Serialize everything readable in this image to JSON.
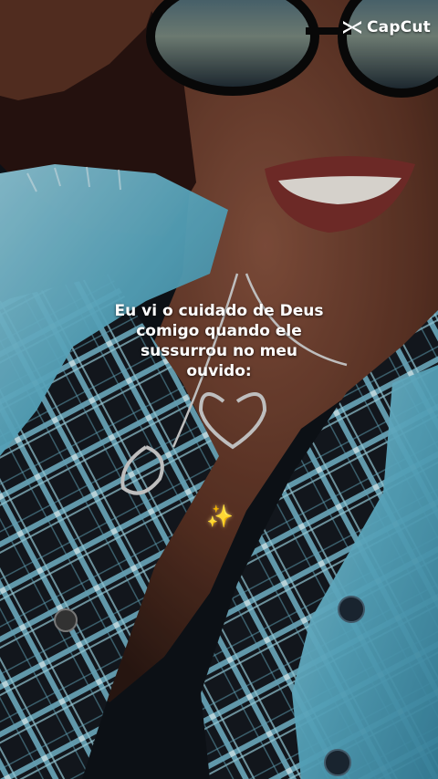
{
  "watermark": {
    "text": "CapCut",
    "icon": "capcut-logo-icon"
  },
  "caption": {
    "lines": [
      "Eu vi o cuidado de Deus",
      "comigo quando ele",
      "sussurrou no meu",
      "ouvido:"
    ]
  },
  "sticker": {
    "glyph": "✨",
    "icon": "sparkles-icon"
  },
  "colors": {
    "plaid_dark": "#151a20",
    "plaid_light": "#8fd2e6",
    "denim": "#6cc4dd",
    "skin": "#6a3d2c",
    "caption_text": "#ffffff"
  }
}
